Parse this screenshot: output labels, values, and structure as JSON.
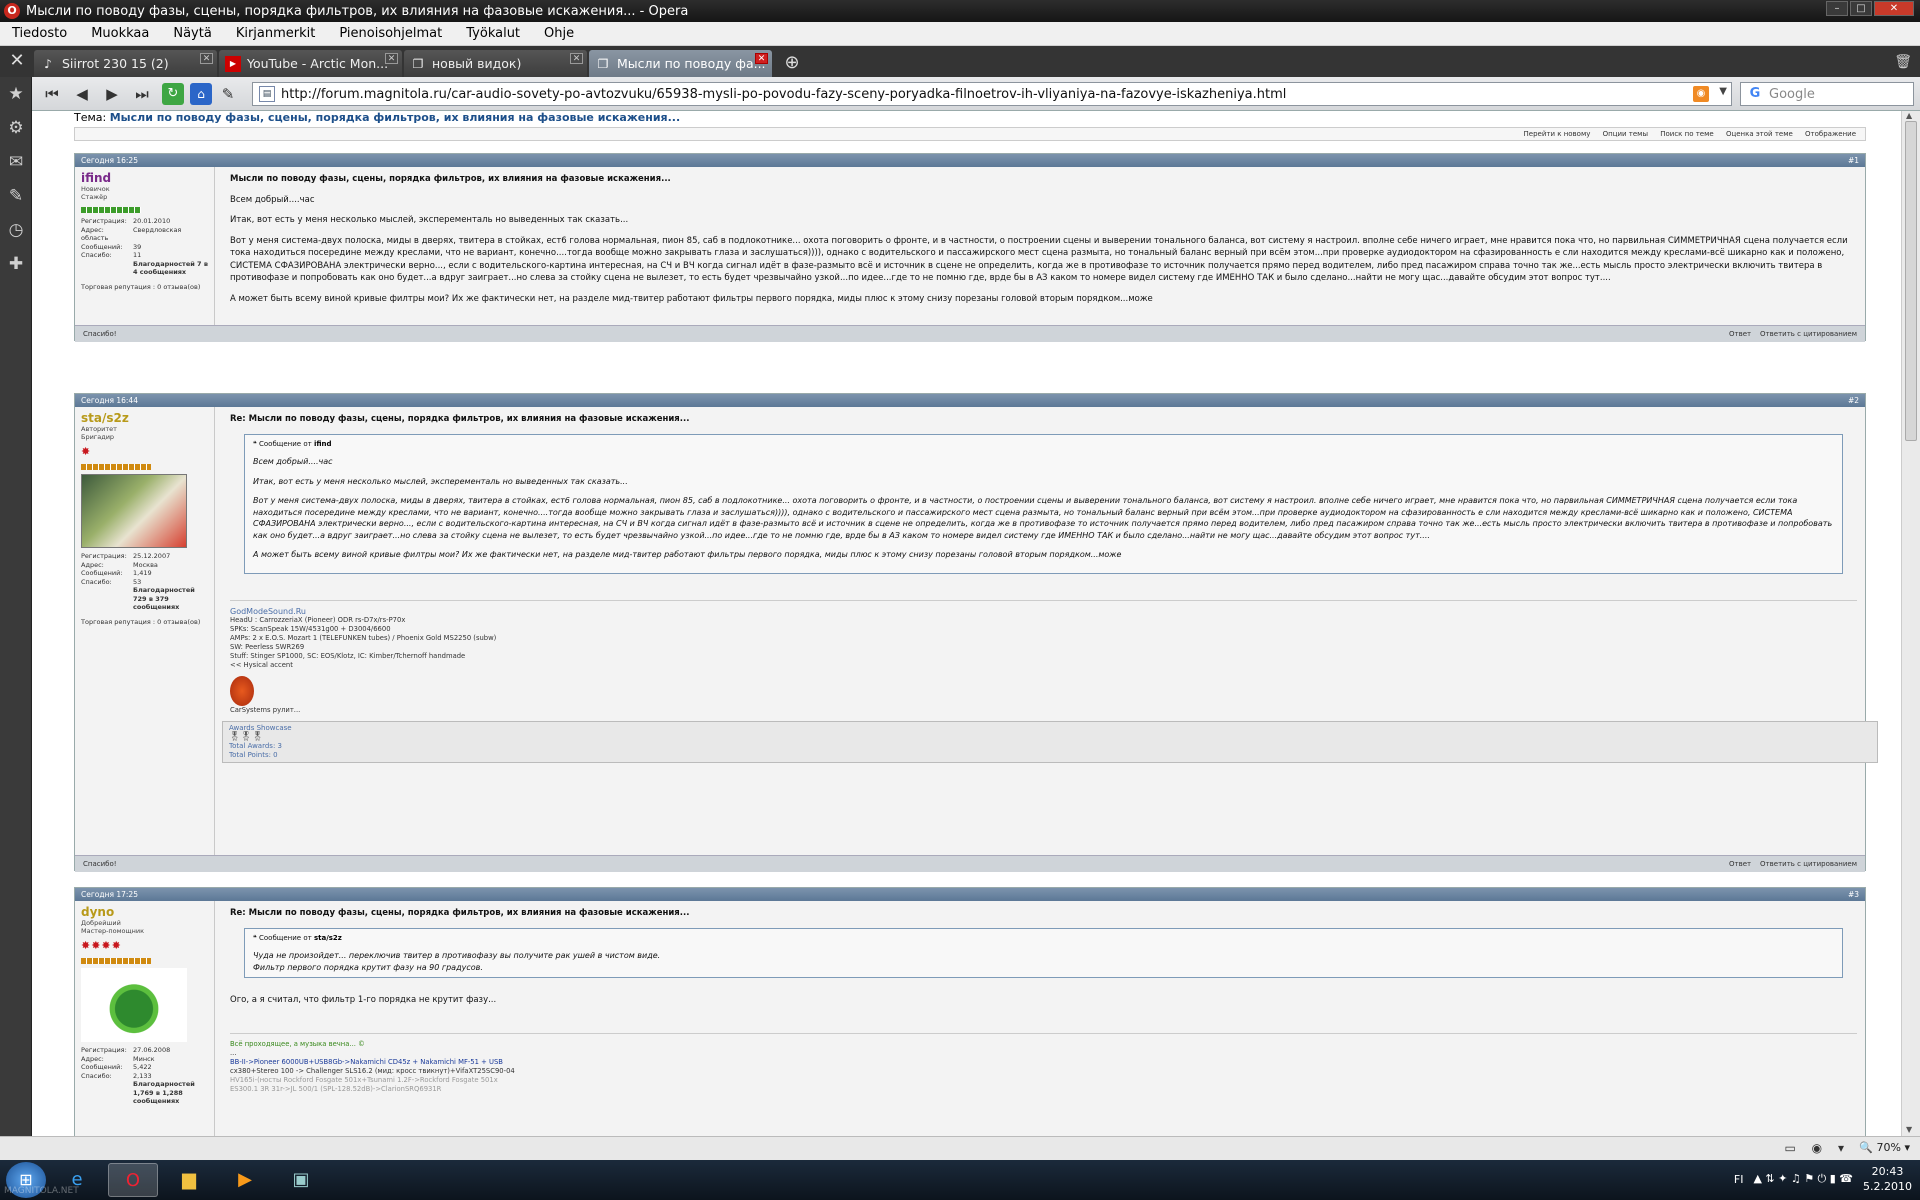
{
  "window": {
    "title": "Мысли по поводу фазы, сцены, порядка фильтров, их влияния на фазовые искажения... - Opera",
    "app_icon": "opera-icon"
  },
  "menu": [
    "Tiedosto",
    "Muokkaa",
    "Näytä",
    "Kirjanmerkit",
    "Pienoisohjelmat",
    "Työkalut",
    "Ohje"
  ],
  "tabs": [
    {
      "label": "Siirrot 230 15 (2)",
      "icon": "download-icon",
      "active": false
    },
    {
      "label": "YouTube - Arctic Mon...",
      "icon": "youtube-icon",
      "active": false
    },
    {
      "label": "новый видок)",
      "icon": "page-icon",
      "active": false
    },
    {
      "label": "Мысли по поводу фа...",
      "icon": "page-icon",
      "active": true
    }
  ],
  "address": {
    "url": "http://forum.magnitola.ru/car-audio-sovety-po-avtozvuku/65938-mysli-po-povodu-fazy-sceny-poryadka-filnoetrov-ih-vliyaniya-na-fazovye-iskazheniya.html"
  },
  "search": {
    "placeholder": "Google"
  },
  "topic": {
    "label": "Тема:",
    "title": "Мысли по поводу фазы, сцены, порядка фильтров, их влияния на фазовые искажения..."
  },
  "tools": [
    "Перейти к новому",
    "Опции темы",
    "Поиск по теме",
    "Оценка этой теме",
    "Отображение"
  ],
  "posts": [
    {
      "date": "Сегодня 16:25",
      "num": "#1",
      "user": {
        "name": "ifind",
        "title1": "Новичок",
        "title2": "Стажёр",
        "stats": [
          [
            "Регистрация:",
            "20.01.2010"
          ],
          [
            "Адрес:",
            "Свердловская область"
          ],
          [
            "Сообщений:",
            "39"
          ],
          [
            "Спасибо:",
            "11"
          ]
        ],
        "thanks": "Благодарностей 7 в 4 сообщениях",
        "rep": "Торговая репутация : 0 отзыва(ов)"
      },
      "title": "Мысли по поводу фазы, сцены, порядка фильтров, их влияния на фазовые искажения...",
      "paragraphs": [
        "Всем добрый....час",
        "Итак, вот есть у меня несколько мыслей, эксперементаль но выведенных так сказать...",
        "Вот у меня система-двух полоска, миды в дверях, твитера в стойках, ест6 голова нормальная, пион 85, саб в подлокотнике... охота поговорить о фронте, и в частности, о построении сцены и выверении тонального баланса, вот систему я настроил. вполне себе ничего играет, мне нравится пока что, но парвильная СИММЕТРИЧНАЯ сцена получается если тока находиться посередине между креслами, что не вариант, конечно....тогда вообще можно закрывать глаза и заслушаться)))), однако с водительского и пассажирского мест сцена размыта, но тональный баланс верный при всём этом...при проверке аудиодоктором на сфазированность е сли находится между креслами-всё шикарно как и положено, СИСТЕМА СФАЗИРОВАНА электрически верно..., если с водительского-картина интересная, на СЧ и ВЧ когда сигнал идёт в фазе-размыто всё и источник в сцене не определить, когда же в противофазе то источник получается прямо перед водителем, либо пред пасажиром справа точно так же...есть мысль просто электрически включить твитера в противофазе и попробовать как оно будет...а вдруг заиграет...но слева за стойку сцена не вылезет, то есть будет чрезвычайно узкой...по идее...где то не помню где, врде бы в АЗ каком то номере видел систему где ИМЕННО ТАК и было сделано...найти не могу щас...давайте обсудим этот вопрос тут....",
        "А может быть всему виной кривые филтры мои? Их же фактически нет, на разделе мид-твитер работают фильтры первого порядка, миды плюс к этому снизу порезаны головой вторым порядком...може"
      ],
      "foot_left": "Спасибо!",
      "foot_right": [
        "Ответ",
        "Ответить с цитированием"
      ]
    },
    {
      "date": "Сегодня 16:44",
      "num": "#2",
      "user": {
        "name": "sta/s2z",
        "title1": "Авторитет",
        "title2": "Бригадир",
        "stats": [
          [
            "Регистрация:",
            "25.12.2007"
          ],
          [
            "Адрес:",
            "Москва"
          ],
          [
            "Сообщений:",
            "1,419"
          ],
          [
            "Спасибо:",
            "53"
          ]
        ],
        "thanks": "Благодарностей 729 в 379 сообщениях",
        "rep": "Торговая репутация : 0 отзыва(ов)"
      },
      "title": "Re: Мысли по поводу фазы, сцены, порядка фильтров, их влияния на фазовые искажения...",
      "quote_from": "Сообщение от",
      "quote_author": "ifind",
      "quote": [
        "Всем добрый....час",
        "Итак, вот есть у меня несколько мыслей, эксперементаль но выведенных так сказать...",
        "Вот у меня система-двух полоска, миды в дверях, твитера в стойках, ест6 голова нормальная, пион 85, саб в подлокотнике... охота поговорить о фронте, и в частности, о построении сцены и выверении тонального баланса, вот систему я настроил. вполне себе ничего играет, мне нравится пока что, но парвильная СИММЕТРИЧНАЯ сцена получается если тока находиться посередине между креслами, что не вариант, конечно....тогда вообще можно закрывать глаза и заслушаться)))), однако с водительского и пассажирского мест сцена размыта, но тональный баланс верный при всём этом...при проверке аудиодоктором на сфазированность е сли находится между креслами-всё шикарно как и положено, СИСТЕМА СФАЗИРОВАНА электрически верно..., если с водительского-картина интересная, на СЧ и ВЧ когда сигнал идёт в фазе-размыто всё и источник в сцене не определить, когда же в противофазе то источник получается прямо перед водителем, либо пред пасажиром справа точно так же...есть мысль просто электрически включить твитера в противофазе и попробовать как оно будет...а вдруг заиграет...но слева за стойку сцена не вылезет, то есть будет чрезвычайно узкой...по идее...где то не помню где, врде бы в АЗ каком то номере видел систему где ИМЕННО ТАК и было сделано...найти не могу щас...давайте обсудим этот вопрос тут....",
        "А может быть всему виной кривые филтры мои? Их же фактически нет, на разделе мид-твитер работают фильтры первого порядка, миды плюс к этому снизу порезаны головой вторым порядком...може"
      ],
      "sig": [
        "GodModeSound.Ru",
        "HeadU : CarrozzeriaX (Pioneer) ODR rs-D7x/rs-P70x",
        "SPKs: ScanSpeak 15W/4531g00 + D3004/6600",
        "AMPs: 2 x E.O.S. Mozart 1 (TELEFUNKEN tubes) / Phoenix Gold MS2250 (subw)",
        "SW: Peerless SWR269",
        "Stuff: Stinger SP1000, SC: EOS/Klotz, IC: Kimber/Tchernoff handmade",
        "<< Hysical accent",
        "CarSystems рулит...",
        "Awards Showcase",
        "Total Awards: 3",
        "Total Points: 0"
      ],
      "foot_left": "Спасибо!",
      "foot_right": [
        "Ответ",
        "Ответить с цитированием"
      ]
    },
    {
      "date": "Сегодня 17:25",
      "num": "#3",
      "user": {
        "name": "dyno",
        "title1": "Добрейший",
        "title2": "Мастер-помощник",
        "stats": [
          [
            "Регистрация:",
            "27.06.2008"
          ],
          [
            "Адрес:",
            "Минск"
          ],
          [
            "Сообщений:",
            "5,422"
          ],
          [
            "Спасибо:",
            "2,133"
          ]
        ],
        "thanks": "Благодарностей 1,769 в 1,288 сообщениях",
        "rep": ""
      },
      "title": "Re: Мысли по поводу фазы, сцены, порядка фильтров, их влияния на фазовые искажения...",
      "quote_from": "Сообщение от",
      "quote_author": "sta/s2z",
      "quote": [
        "Чуда не произойдет... переключив твитер в противофазу вы получите рак ушей в чистом виде.",
        "Фильтр первого порядка крутит фазу на 90 градусов."
      ],
      "paragraphs": [
        "Ого, а я считал, что фильтр 1-го порядка не крутит фазу..."
      ],
      "sig": [
        "Всё проходящее, а музыка вечна... ©",
        "...",
        "BB-II->Pioneer 6000UB+USB8Gb->Nakamichi CD45z + Nakamichi MF-51 + USB",
        "cx380+Stereo 100 -> Challenger SLS16.2 (мид: кросс твикнут)+VifaXT25SC90-04",
        "HV165i-(носты Rockford Fosgate 501x+Tsunami 1.2F->Rockford Fosgate 501x",
        "ES300.1 3R 31r->JL 500/1 (SPL-128.52dB)->ClarionSRQ6931R"
      ]
    }
  ],
  "statusbar": {
    "zoom": "70%"
  },
  "taskbar": {
    "lang": "FI",
    "time": "20:43",
    "date": "5.2.2010",
    "watermark": "MAGNITOLA.NET"
  }
}
